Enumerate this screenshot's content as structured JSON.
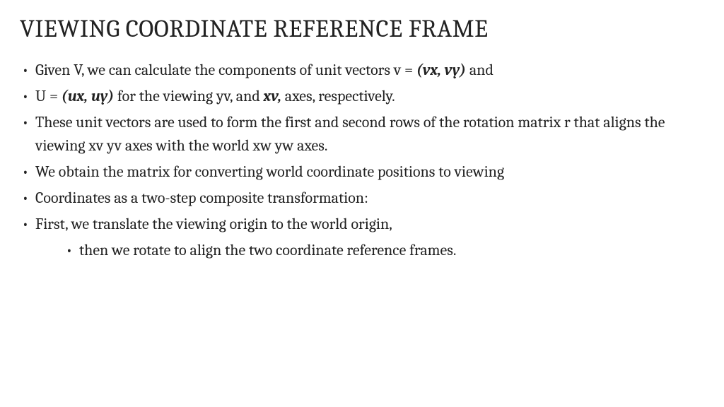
{
  "title": "VIEWING COORDINATE REFERENCE FRAME",
  "bullets": {
    "b1_pre": "Given V, we can calculate the components of unit vectors v = ",
    "b1_bold": "(vx, vy)",
    "b1_post": " and",
    "b2_pre": "U = ",
    "b2_bold1": "(ux, uy)",
    "b2_mid": " for the viewing yv, and ",
    "b2_bold2": "xv,",
    "b2_post": " axes, respectively.",
    "b3": "These unit vectors are used to form the first and second rows of the rotation matrix r that aligns the viewing xv yv axes with the world xw yw axes.",
    "b4": "We obtain the matrix for converting world coordinate positions to viewing",
    "b5": "Coordinates as a two-step composite transformation:",
    "b6": "First, we translate the viewing origin to the world origin,",
    "sub1": "then we rotate to align the two coordinate reference frames."
  }
}
